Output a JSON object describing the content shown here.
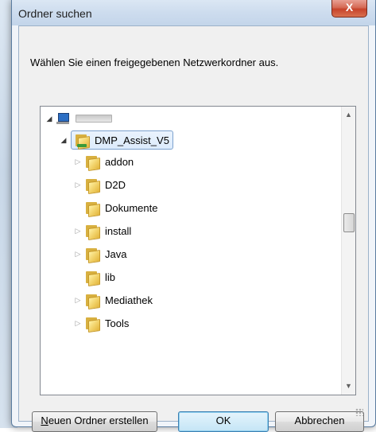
{
  "window": {
    "title": "Ordner suchen",
    "close_glyph": "X"
  },
  "instruction": "Wählen Sie einen freigegebenen Netzwerkordner aus.",
  "tree": {
    "root_expander": "◢",
    "root_icon": "computer-icon",
    "items": [
      {
        "label": "DMP_Assist_V5",
        "expander": "◢",
        "selected": true,
        "shared": true
      },
      {
        "label": "addon",
        "expander": "▷"
      },
      {
        "label": "D2D",
        "expander": "▷"
      },
      {
        "label": "Dokumente",
        "expander": ""
      },
      {
        "label": "install",
        "expander": "▷"
      },
      {
        "label": "Java",
        "expander": "▷"
      },
      {
        "label": "lib",
        "expander": ""
      },
      {
        "label": "Mediathek",
        "expander": "▷"
      },
      {
        "label": "Tools",
        "expander": "▷"
      }
    ]
  },
  "scrollbar": {
    "up_arrow": "▲",
    "down_arrow": "▼"
  },
  "buttons": {
    "new_folder_prefix": "N",
    "new_folder_rest": "euen Ordner erstellen",
    "ok": "OK",
    "cancel": "Abbrechen"
  },
  "colors": {
    "close_button": "#c7432b",
    "selection_border": "#7da2ce",
    "default_button_border": "#3c7fb1"
  }
}
